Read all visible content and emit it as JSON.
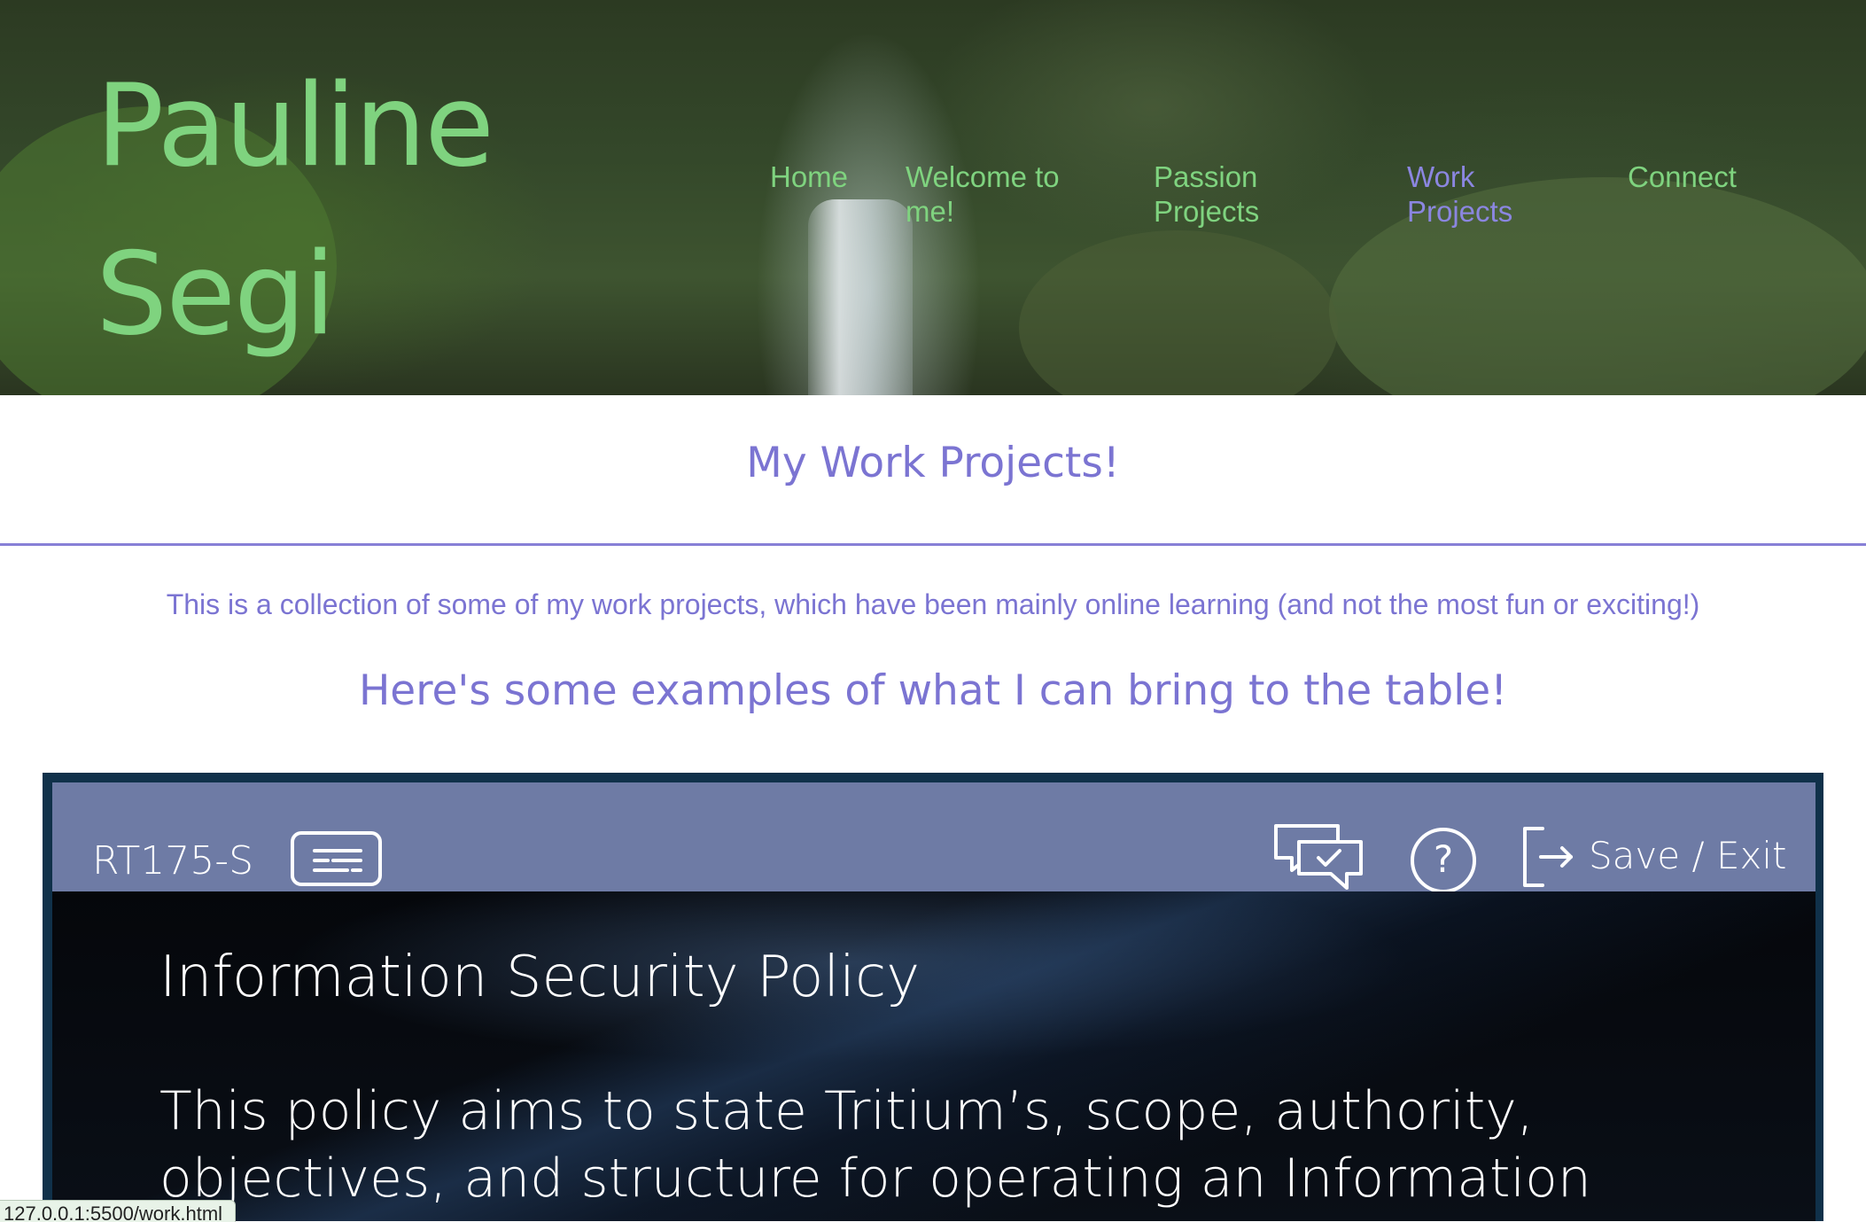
{
  "site": {
    "title": "Pauline Segi",
    "nav": [
      {
        "label": "Home"
      },
      {
        "label": "Welcome to me!"
      },
      {
        "label": "Passion Projects"
      },
      {
        "label": "Work Projects",
        "active": true
      },
      {
        "label": "Connect"
      }
    ]
  },
  "main": {
    "heading": "My Work Projects!",
    "intro": "This is a collection of some of my work projects, which have been mainly online learning (and not the most fun or exciting!)",
    "subheading": "Here's some examples of what I can bring to the table!"
  },
  "course": {
    "code": "RT175-S",
    "menu_icon": "menu-lines-icon",
    "chat_icon": "chat-bubbles-check-icon",
    "help_icon": "question-mark-icon",
    "help_glyph": "?",
    "exit_icon": "exit-arrow-icon",
    "exit_label": "Save / Exit",
    "slide_title": "Information Security Policy",
    "slide_text": "This policy aims to state Tritium’s, scope, authority, objectives, and structure for operating an Information"
  },
  "status_bar": {
    "url": "127.0.0.1:5500/work.html"
  },
  "colors": {
    "title_green": "#7fd37f",
    "accent_purple": "#7b74d2",
    "course_bar": "#6e7ba5",
    "course_border": "#10314a"
  }
}
